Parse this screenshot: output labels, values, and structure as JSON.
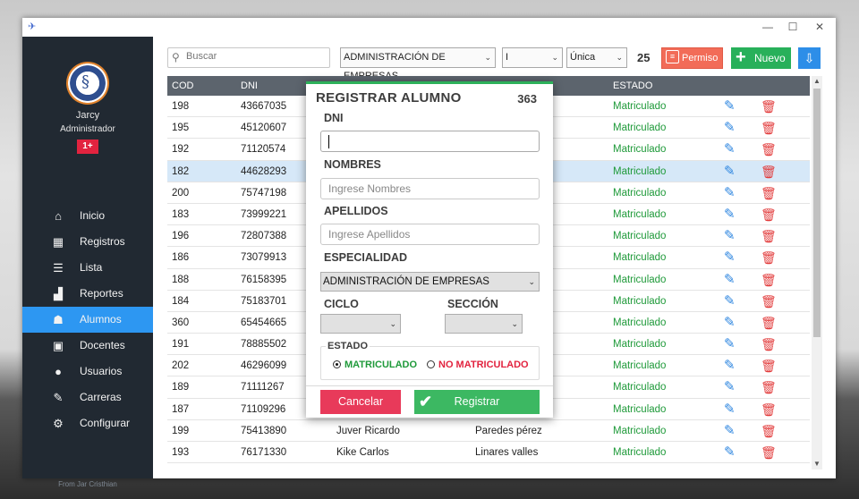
{
  "window": {
    "minimize": "—",
    "maximize": "☐",
    "close": "✕",
    "app_icon": "✈"
  },
  "sidebar": {
    "user_name": "Jarcy",
    "user_role": "Administrador",
    "badge": "1+",
    "footer": "From Jar Cristhian",
    "items": [
      {
        "label": "Inicio",
        "icon": "home-icon",
        "glyph": "⌂"
      },
      {
        "label": "Registros",
        "icon": "calendar-icon",
        "glyph": "▦"
      },
      {
        "label": "Lista",
        "icon": "list-icon",
        "glyph": "☰"
      },
      {
        "label": "Reportes",
        "icon": "chart-icon",
        "glyph": "▟"
      },
      {
        "label": "Alumnos",
        "icon": "walking-person-icon",
        "glyph": "☗"
      },
      {
        "label": "Docentes",
        "icon": "teacher-icon",
        "glyph": "▣"
      },
      {
        "label": "Usuarios",
        "icon": "user-icon",
        "glyph": "●"
      },
      {
        "label": "Carreras",
        "icon": "edit-icon",
        "glyph": "✎"
      },
      {
        "label": "Configurar",
        "icon": "gear-icon",
        "glyph": "⚙"
      }
    ],
    "active_index": 4
  },
  "toolbar": {
    "search_placeholder": "Buscar",
    "search_glyph": "⚲",
    "especialidad": "ADMINISTRACIÓN DE EMPRESAS",
    "ciclo": "I",
    "seccion": "Única",
    "caret": "⌄",
    "count": "25",
    "permiso_label": "Permiso",
    "permiso_glyph": "≡",
    "nuevo_label": "Nuevo",
    "nuevo_glyph": "+",
    "export_glyph": "⇩"
  },
  "table": {
    "headers": {
      "cod": "COD",
      "dni": "DNI",
      "estado": "ESTADO"
    },
    "edit_glyph": "✎",
    "delete_glyph": "🗑",
    "selected_index": 3,
    "rows": [
      {
        "cod": "198",
        "dni": "43667035",
        "nombres": "",
        "apellidos": "rón",
        "estado": "Matriculado"
      },
      {
        "cod": "195",
        "dni": "45120607",
        "nombres": "",
        "apellidos": "",
        "estado": "Matriculado"
      },
      {
        "cod": "192",
        "dni": "71120574",
        "nombres": "",
        "apellidos": "",
        "estado": "Matriculado"
      },
      {
        "cod": "182",
        "dni": "44628293",
        "nombres": "",
        "apellidos": "",
        "estado": "Matriculado"
      },
      {
        "cod": "200",
        "dni": "75747198",
        "nombres": "",
        "apellidos": "",
        "estado": "Matriculado"
      },
      {
        "cod": "183",
        "dni": "73999221",
        "nombres": "",
        "apellidos": "",
        "estado": "Matriculado"
      },
      {
        "cod": "196",
        "dni": "72807388",
        "nombres": "",
        "apellidos": "",
        "estado": "Matriculado"
      },
      {
        "cod": "186",
        "dni": "73079913",
        "nombres": "",
        "apellidos": "",
        "estado": "Matriculado"
      },
      {
        "cod": "188",
        "dni": "76158395",
        "nombres": "",
        "apellidos": "",
        "estado": "Matriculado"
      },
      {
        "cod": "184",
        "dni": "75183701",
        "nombres": "",
        "apellidos": "",
        "estado": "Matriculado"
      },
      {
        "cod": "360",
        "dni": "65454665",
        "nombres": "",
        "apellidos": "",
        "estado": "Matriculado"
      },
      {
        "cod": "191",
        "dni": "78885502",
        "nombres": "",
        "apellidos": "",
        "estado": "Matriculado"
      },
      {
        "cod": "202",
        "dni": "46296099",
        "nombres": "",
        "apellidos": "",
        "estado": "Matriculado"
      },
      {
        "cod": "189",
        "dni": "71111267",
        "nombres": "",
        "apellidos": "",
        "estado": "Matriculado"
      },
      {
        "cod": "187",
        "dni": "71109296",
        "nombres": "",
        "apellidos": "",
        "estado": "Matriculado"
      },
      {
        "cod": "199",
        "dni": "75413890",
        "nombres": "Juver Ricardo",
        "apellidos": "Paredes pérez",
        "estado": "Matriculado"
      },
      {
        "cod": "193",
        "dni": "76171330",
        "nombres": "Kike Carlos",
        "apellidos": "Linares valles",
        "estado": "Matriculado"
      }
    ]
  },
  "modal": {
    "title": "REGISTRAR ALUMNO",
    "count": "363",
    "dni_label": "DNI",
    "dni_value": "",
    "nombres_label": "NOMBRES",
    "nombres_placeholder": "Ingrese Nombres",
    "apellidos_label": "APELLIDOS",
    "apellidos_placeholder": "Ingrese Apellidos",
    "especialidad_label": "ESPECIALIDAD",
    "especialidad_value": "ADMINISTRACIÓN DE EMPRESAS",
    "ciclo_label": "CICLO",
    "ciclo_value": "",
    "seccion_label": "SECCIÓN",
    "seccion_value": "",
    "estado_label": "ESTADO",
    "radio_matriculado": "MATRICULADO",
    "radio_no_matriculado": "NO MATRICULADO",
    "selected_estado": "MATRICULADO",
    "cancel_label": "Cancelar",
    "register_label": "Registrar",
    "register_glyph": "✔"
  },
  "colors": {
    "sidebar_bg": "#212932",
    "active_nav": "#2d97f2",
    "estado_green": "#1f9a3a",
    "delete_red": "#e23b3b",
    "edit_blue": "#2e86e0",
    "nuevo_green": "#28b05a",
    "permiso_red": "#f26c58"
  }
}
